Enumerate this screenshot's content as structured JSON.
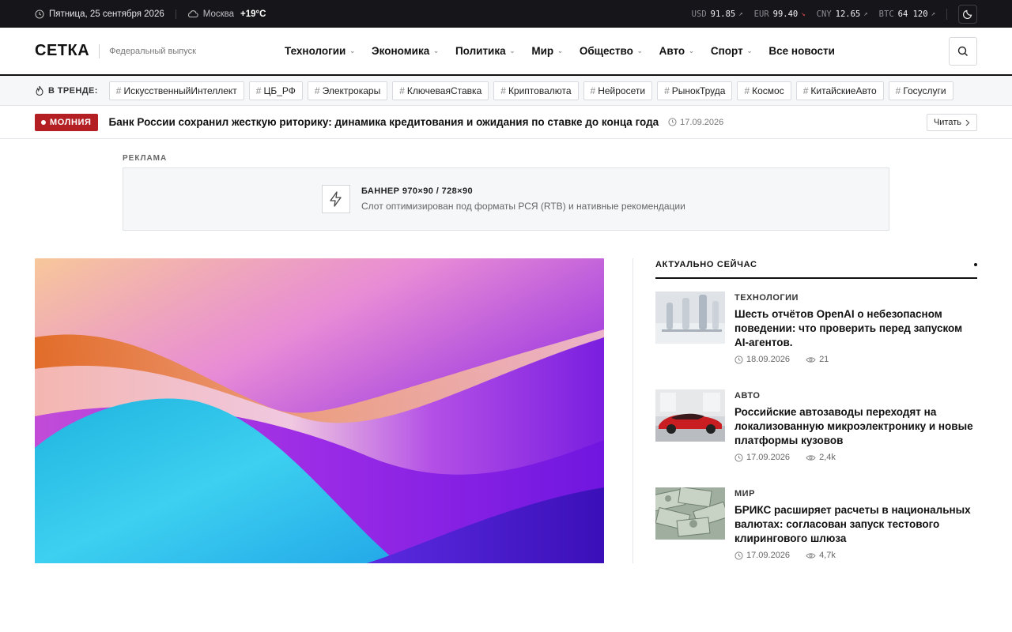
{
  "topbar": {
    "date": "Пятница, 25 сентября 2026",
    "city": "Москва",
    "temperature": "+19°C",
    "rates": [
      {
        "code": "USD",
        "value": "91.85",
        "arrow": "↗",
        "direction": "up"
      },
      {
        "code": "EUR",
        "value": "99.40",
        "arrow": "↘",
        "direction": "down"
      },
      {
        "code": "CNY",
        "value": "12.65",
        "arrow": "↗",
        "direction": "up"
      },
      {
        "code": "BTC",
        "value": "64 120",
        "arrow": "↗",
        "direction": "up"
      }
    ]
  },
  "header": {
    "logo": "СЕТКА",
    "edition": "Федеральный выпуск",
    "nav": [
      {
        "label": "Технологии",
        "dropdown": true
      },
      {
        "label": "Экономика",
        "dropdown": true
      },
      {
        "label": "Политика",
        "dropdown": true
      },
      {
        "label": "Мир",
        "dropdown": true
      },
      {
        "label": "Общество",
        "dropdown": true
      },
      {
        "label": "Авто",
        "dropdown": true
      },
      {
        "label": "Спорт",
        "dropdown": true
      },
      {
        "label": "Все новости",
        "dropdown": false
      }
    ]
  },
  "trending": {
    "label": "В ТРЕНДЕ:",
    "tags": [
      "ИскусственныйИнтеллект",
      "ЦБ_РФ",
      "Электрокары",
      "КлючеваяСтавка",
      "Криптовалюта",
      "Нейросети",
      "РынокТруда",
      "Космос",
      "КитайскиеАвто",
      "Госуслуги"
    ]
  },
  "breaking": {
    "badge": "МОЛНИЯ",
    "title": "Банк России сохранил жесткую риторику: динамика кредитования и ожидания по ставке до конца года",
    "date": "17.09.2026",
    "read_label": "Читать"
  },
  "ad": {
    "label": "РЕКЛАМА",
    "title": "БАННЕР 970×90 / 728×90",
    "subtitle": "Слот оптимизирован под форматы РСЯ (RTB) и нативные рекомендации"
  },
  "sidebar": {
    "heading": "АКТУАЛЬНО СЕЙЧАС",
    "items": [
      {
        "category": "ТЕХНОЛОГИИ",
        "title": "Шесть отчётов OpenAI о небезопасном поведении: что проверить перед запуском AI-агентов.",
        "date": "18.09.2026",
        "views": "21"
      },
      {
        "category": "АВТО",
        "title": "Российские автозаводы переходят на локализованную микроэлектронику и новые платформы кузовов",
        "date": "17.09.2026",
        "views": "2,4k"
      },
      {
        "category": "МИР",
        "title": "БРИКС расширяет расчеты в национальных валютах: согласован запуск тестового клирингового шлюза",
        "date": "17.09.2026",
        "views": "4,7k"
      }
    ]
  },
  "colors": {
    "accent": "#b41f24",
    "dark": "#16161a"
  }
}
